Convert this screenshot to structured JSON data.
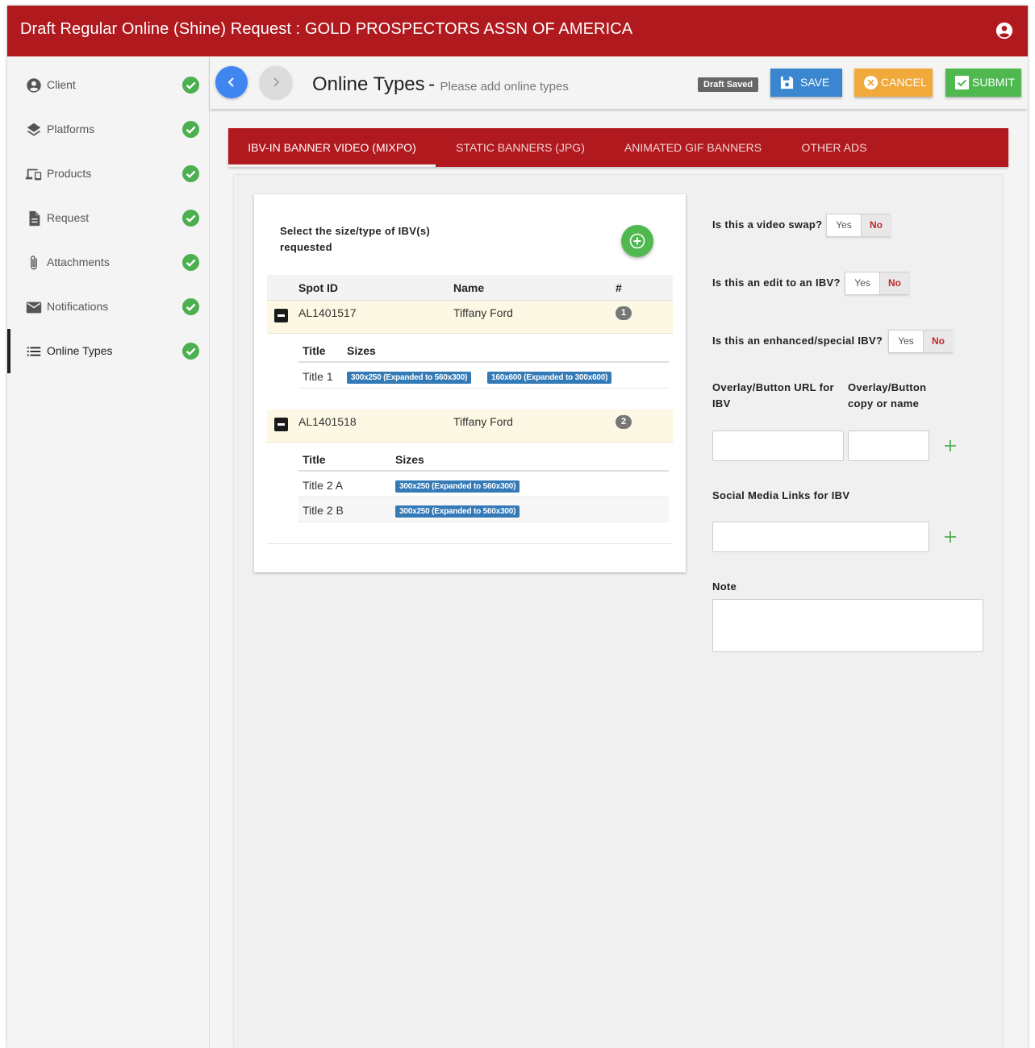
{
  "header": {
    "title": "Draft Regular Online (Shine) Request : GOLD PROSPECTORS ASSN OF AMERICA"
  },
  "sidebar": {
    "items": [
      {
        "label": "Client",
        "icon": "account-circle-icon",
        "complete": true
      },
      {
        "label": "Platforms",
        "icon": "layers-icon",
        "complete": true
      },
      {
        "label": "Products",
        "icon": "devices-icon",
        "complete": true
      },
      {
        "label": "Request",
        "icon": "document-icon",
        "complete": true
      },
      {
        "label": "Attachments",
        "icon": "paperclip-icon",
        "complete": true
      },
      {
        "label": "Notifications",
        "icon": "mail-icon",
        "complete": true
      },
      {
        "label": "Online Types",
        "icon": "list-icon",
        "complete": true,
        "active": true
      }
    ]
  },
  "toolbar": {
    "page_title": "Online Types",
    "separator": "-",
    "subtitle": "Please add online types",
    "status_badge": "Draft Saved",
    "save_label": "SAVE",
    "cancel_label": "CANCEL",
    "submit_label": "SUBMIT"
  },
  "tabs": [
    {
      "label": "IBV-IN BANNER VIDEO (MIXPO)",
      "active": true
    },
    {
      "label": "STATIC BANNERS (JPG)",
      "active": false
    },
    {
      "label": "ANIMATED GIF BANNERS",
      "active": false
    },
    {
      "label": "OTHER ADS",
      "active": false
    }
  ],
  "ibv_card": {
    "select_label": "Select the size/type of IBV(s) requested",
    "columns": {
      "spot_id": "Spot ID",
      "name": "Name",
      "count": "#"
    },
    "spots": [
      {
        "spot_id": "AL1401517",
        "name": "Tiffany Ford",
        "count": "1",
        "sub_columns": {
          "title": "Title",
          "sizes": "Sizes"
        },
        "rows": [
          {
            "title": "Title 1",
            "sizes": [
              "300x250 (Expanded to 560x300)",
              "160x600 (Expanded to 300x600)"
            ]
          }
        ]
      },
      {
        "spot_id": "AL1401518",
        "name": "Tiffany Ford",
        "count": "2",
        "sub_columns": {
          "title": "Title",
          "sizes": "Sizes"
        },
        "rows": [
          {
            "title": "Title 2 A",
            "sizes": [
              "300x250 (Expanded to 560x300)"
            ]
          },
          {
            "title": "Title 2 B",
            "sizes": [
              "300x250 (Expanded to 560x300)"
            ]
          }
        ]
      }
    ]
  },
  "form": {
    "video_swap": {
      "label": "Is this a video swap?",
      "yes": "Yes",
      "no": "No",
      "selected": "No"
    },
    "edit_ibv": {
      "label": "Is this an edit to an IBV?",
      "yes": "Yes",
      "no": "No",
      "selected": "No"
    },
    "enhanced_ibv": {
      "label": "Is this an enhanced/special IBV?",
      "yes": "Yes",
      "no": "No",
      "selected": "No"
    },
    "overlay_url_label": "Overlay/Button URL for IBV",
    "overlay_copy_label": "Overlay/Button copy or name",
    "overlay_url_value": "",
    "overlay_copy_value": "",
    "social_label": "Social Media Links for IBV",
    "social_value": "",
    "note_label": "Note",
    "note_value": ""
  },
  "colors": {
    "brand_red": "#b0191e",
    "save_blue": "#3a86d0",
    "cancel_orange": "#f2a93b",
    "submit_green": "#4fb84f",
    "check_green": "#4caf50",
    "size_tag_blue": "#337ab7",
    "row_highlight": "#fcf8e3"
  }
}
